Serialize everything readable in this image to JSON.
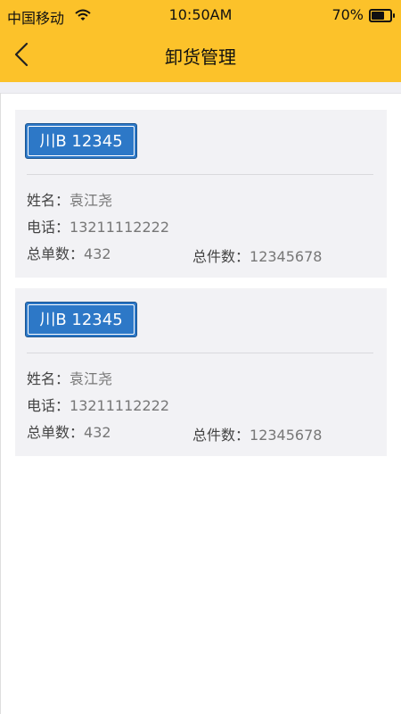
{
  "status_bar": {
    "carrier": "中国移动",
    "time": "10:50AM",
    "battery": "70%",
    "battery_level": 0.7
  },
  "nav": {
    "title": "卸货管理"
  },
  "cards": [
    {
      "plate": "川B 12345",
      "name_label": "姓名：",
      "name": "袁江尧",
      "phone_label": "电话：",
      "phone": "13211112222",
      "orders_label": "总单数：",
      "orders": "432",
      "pieces_label": "总件数：",
      "pieces": "12345678"
    },
    {
      "plate": "川B 12345",
      "name_label": "姓名：",
      "name": "袁江尧",
      "phone_label": "电话：",
      "phone": "13211112222",
      "orders_label": "总单数：",
      "orders": "432",
      "pieces_label": "总件数：",
      "pieces": "12345678"
    }
  ]
}
